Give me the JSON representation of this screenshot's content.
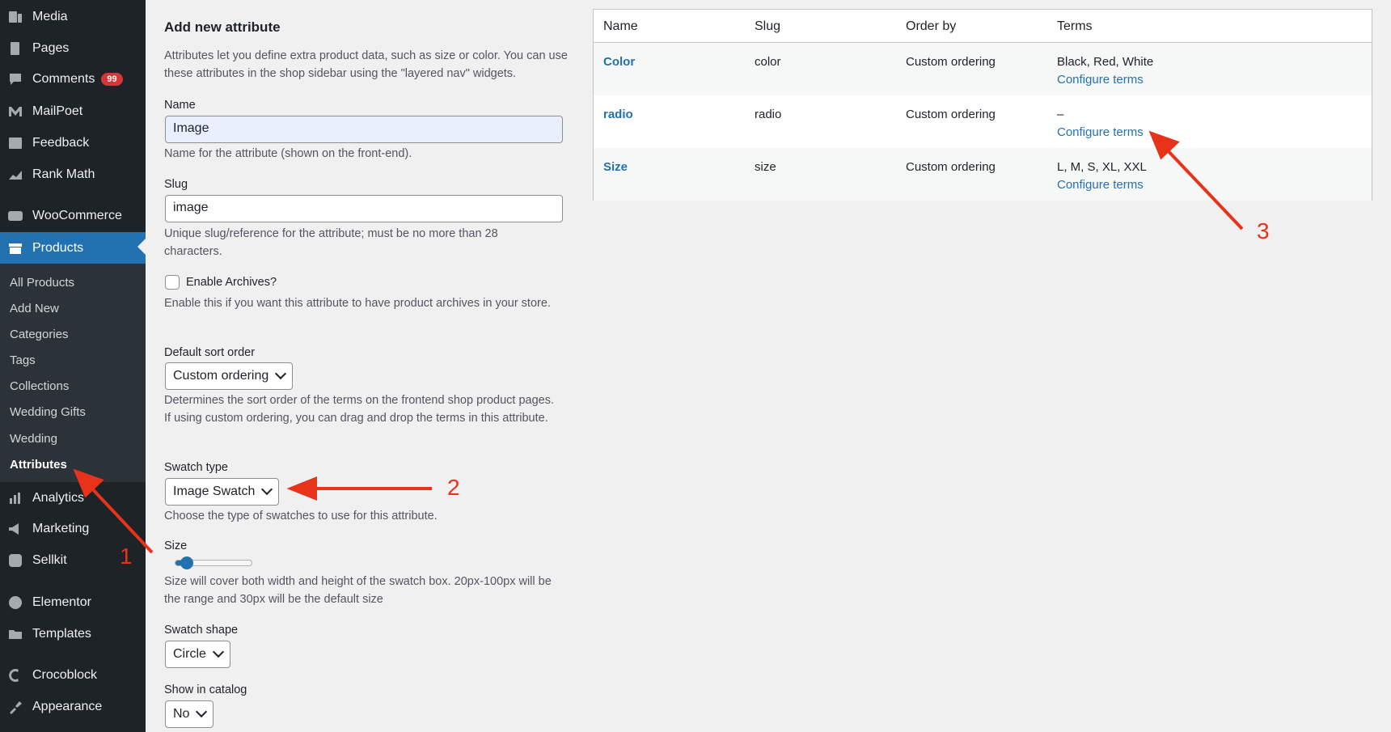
{
  "sidebar": {
    "items": [
      {
        "label": "Media",
        "icon": "media-icon"
      },
      {
        "label": "Pages",
        "icon": "pages-icon"
      },
      {
        "label": "Comments",
        "icon": "comments-icon",
        "badge": "99"
      },
      {
        "label": "MailPoet",
        "icon": "mailpoet-icon"
      },
      {
        "label": "Feedback",
        "icon": "feedback-icon"
      },
      {
        "label": "Rank Math",
        "icon": "rank-math-icon"
      },
      {
        "label": "WooCommerce",
        "icon": "woocommerce-icon"
      },
      {
        "label": "Products",
        "icon": "products-icon"
      },
      {
        "label": "Analytics",
        "icon": "analytics-icon"
      },
      {
        "label": "Marketing",
        "icon": "marketing-icon"
      },
      {
        "label": "Sellkit",
        "icon": "sellkit-icon"
      },
      {
        "label": "Elementor",
        "icon": "elementor-icon"
      },
      {
        "label": "Templates",
        "icon": "templates-icon"
      },
      {
        "label": "Crocoblock",
        "icon": "crocoblock-icon"
      },
      {
        "label": "Appearance",
        "icon": "appearance-icon"
      }
    ],
    "submenu": [
      "All Products",
      "Add New",
      "Categories",
      "Tags",
      "Collections",
      "Wedding Gifts",
      "Wedding",
      "Attributes"
    ]
  },
  "form": {
    "heading": "Add new attribute",
    "intro": "Attributes let you define extra product data, such as size or color. You can use these attributes in the shop sidebar using the \"layered nav\" widgets.",
    "name_label": "Name",
    "name_value": "Image",
    "name_help": "Name for the attribute (shown on the front-end).",
    "slug_label": "Slug",
    "slug_value": "image",
    "slug_help": "Unique slug/reference for the attribute; must be no more than 28 characters.",
    "archives_label": "Enable Archives?",
    "archives_help": "Enable this if you want this attribute to have product archives in your store.",
    "sort_label": "Default sort order",
    "sort_value": "Custom ordering",
    "sort_help": "Determines the sort order of the terms on the frontend shop product pages. If using custom ordering, you can drag and drop the terms in this attribute.",
    "swatch_type_label": "Swatch type",
    "swatch_type_value": "Image Swatch",
    "swatch_type_help": "Choose the type of swatches to use for this attribute.",
    "size_label": "Size",
    "size_fraction": 0.16,
    "size_help": "Size will cover both width and height of the swatch box. 20px-100px will be the range and 30px will be the default size",
    "shape_label": "Swatch shape",
    "shape_value": "Circle",
    "catalog_label": "Show in catalog",
    "catalog_value": "No"
  },
  "table": {
    "headers": [
      "Name",
      "Slug",
      "Order by",
      "Terms"
    ],
    "rows": [
      {
        "name": "Color",
        "slug": "color",
        "order": "Custom ordering",
        "terms": "Black, Red, White",
        "link": "Configure terms"
      },
      {
        "name": "radio",
        "slug": "radio",
        "order": "Custom ordering",
        "terms": "–",
        "link": "Configure terms"
      },
      {
        "name": "Size",
        "slug": "size",
        "order": "Custom ordering",
        "terms": "L, M, S, XL, XXL",
        "link": "Configure terms"
      }
    ]
  },
  "annotations": {
    "labels": [
      "1",
      "2",
      "3"
    ],
    "color": "#e8321a"
  },
  "colors": {
    "sidebar_bg": "#1d2327",
    "accent": "#2271b1",
    "badge": "#d63638"
  }
}
